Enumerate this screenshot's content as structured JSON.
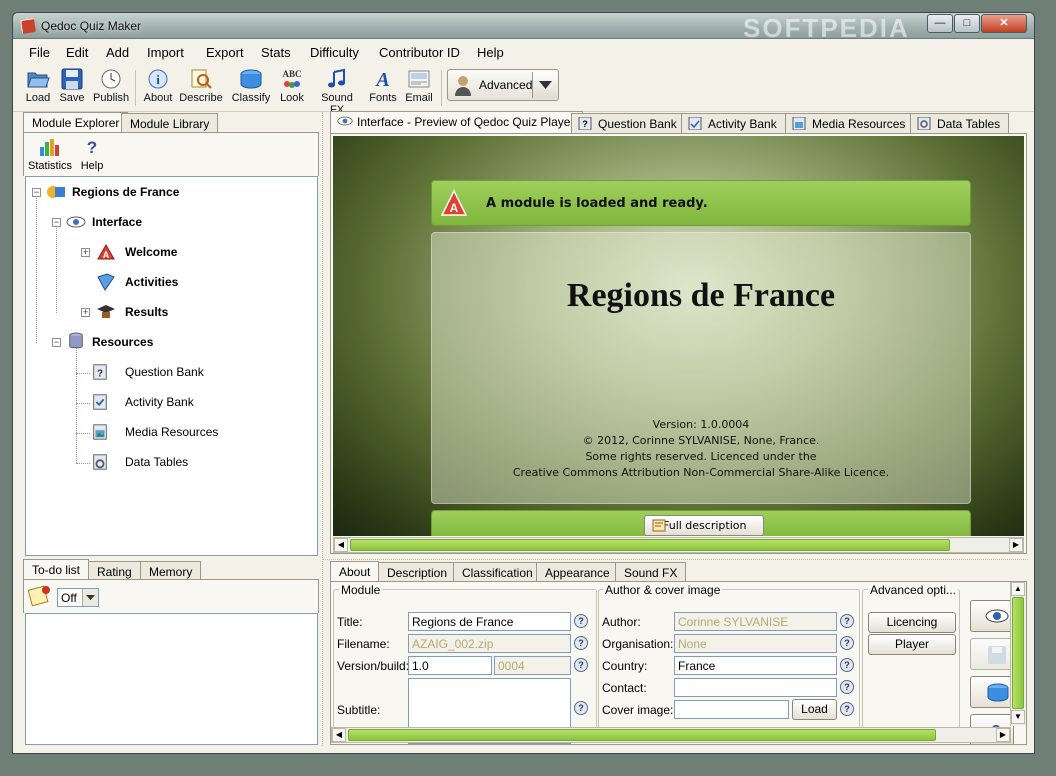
{
  "window": {
    "title": "Qedoc Quiz Maker",
    "watermark": "SOFTPEDIA"
  },
  "menu": [
    "File",
    "Edit",
    "Add",
    "Import",
    "Export",
    "Stats",
    "Difficulty",
    "Contributor ID",
    "Help"
  ],
  "toolbar": {
    "buttons": [
      {
        "label": "Load",
        "icon": "folder-open-icon"
      },
      {
        "label": "Save",
        "icon": "floppy-disk-icon"
      },
      {
        "label": "Publish",
        "icon": "clock-publish-icon"
      },
      {
        "label": "About",
        "icon": "info-icon"
      },
      {
        "label": "Describe",
        "icon": "magnifier-note-icon"
      },
      {
        "label": "Classify",
        "icon": "box-icon"
      },
      {
        "label": "Look",
        "icon": "abc-look-icon"
      },
      {
        "label": "Sound FX",
        "icon": "music-note-icon"
      },
      {
        "label": "Fonts",
        "icon": "font-icon"
      },
      {
        "label": "Email",
        "icon": "email-icon"
      }
    ],
    "mode": "Advanced"
  },
  "left_tabs": [
    "Module Explorer",
    "Module Library"
  ],
  "left_tools": [
    "Statistics",
    "Help"
  ],
  "tree": {
    "root": "Regions de France",
    "interface": "Interface",
    "welcome": "Welcome",
    "activities": "Activities",
    "results": "Results",
    "resources": "Resources",
    "question_bank": "Question Bank",
    "activity_bank": "Activity Bank",
    "media_resources": "Media Resources",
    "data_tables": "Data Tables"
  },
  "bottom_left_tabs": [
    "To-do list",
    "Rating",
    "Memory"
  ],
  "todo_filter": "Off",
  "main_tabs": [
    "Interface - Preview of Qedoc Quiz Player",
    "Question Bank",
    "Activity Bank",
    "Media Resources",
    "Data Tables"
  ],
  "preview": {
    "status": "A module is loaded and ready.",
    "title": "Regions de France",
    "version": "Version: 1.0.0004",
    "copyright": "© 2012, Corinne SYLVANISE, None, France.",
    "rights": "Some rights reserved. Licenced under the",
    "licence": "Creative Commons Attribution Non-Commercial Share-Alike Licence.",
    "full_description": "Full description"
  },
  "bottom_tabs": [
    "About",
    "Description",
    "Classification",
    "Appearance",
    "Sound FX"
  ],
  "module": {
    "legend": "Module",
    "title_label": "Title:",
    "title_value": "Regions de France",
    "filename_label": "Filename:",
    "filename_value": "AZAIG_002.zip",
    "version_label": "Version/build:",
    "version_value": "1.0",
    "build_value": "0004",
    "subtitle_label": "Subtitle:",
    "subtitle_value": ""
  },
  "author": {
    "legend": "Author & cover image",
    "author_label": "Author:",
    "author_value": "Corinne SYLVANISE",
    "org_label": "Organisation:",
    "org_value": "None",
    "country_label": "Country:",
    "country_value": "France",
    "contact_label": "Contact:",
    "contact_value": "",
    "cover_label": "Cover image:",
    "cover_value": "",
    "load_label": "Load"
  },
  "advanced": {
    "legend": "Advanced opti...",
    "licencing": "Licencing",
    "player": "Player"
  },
  "colors": {
    "accent_green": "#8ac43d",
    "panel_border": "#7f9db9",
    "chrome": "#f3f1e8"
  }
}
